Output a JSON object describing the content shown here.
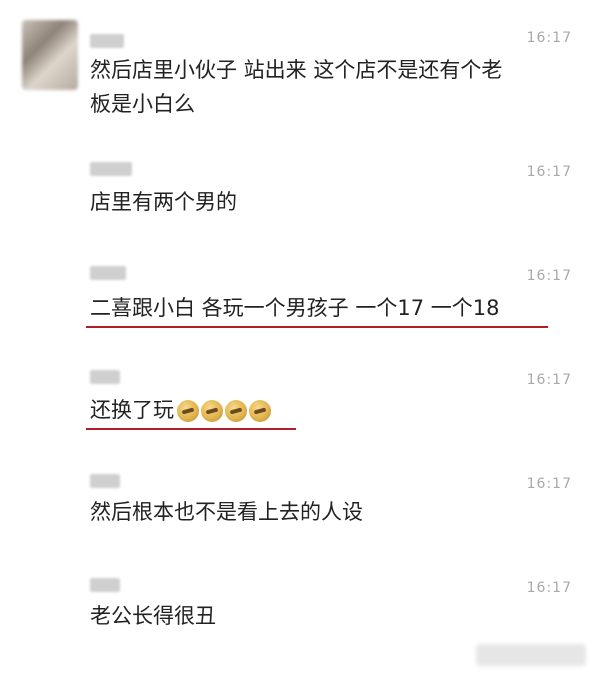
{
  "messages": [
    {
      "time": "16:17",
      "text_lines": [
        "然后店里小伙子 站出来 这个店不是还有个老",
        "板是小白么"
      ]
    },
    {
      "time": "16:17",
      "text_lines": [
        "店里有两个男的"
      ]
    },
    {
      "time": "16:17",
      "text_lines": [
        "二喜跟小白 各玩一个男孩子 一个17 一个18"
      ],
      "underlined": true
    },
    {
      "time": "16:17",
      "text_lines": [
        "还换了玩"
      ],
      "underlined": true,
      "emojis": [
        "grimace-emoji",
        "grimace-emoji",
        "grimace-emoji",
        "grimace-emoji"
      ]
    },
    {
      "time": "16:17",
      "text_lines": [
        "然后根本也不是看上去的人设"
      ]
    },
    {
      "time": "16:17",
      "text_lines": [
        "老公长得很丑"
      ]
    }
  ],
  "colors": {
    "underline": "#b01e2a",
    "time": "#a9a9a9",
    "text": "#222222"
  }
}
